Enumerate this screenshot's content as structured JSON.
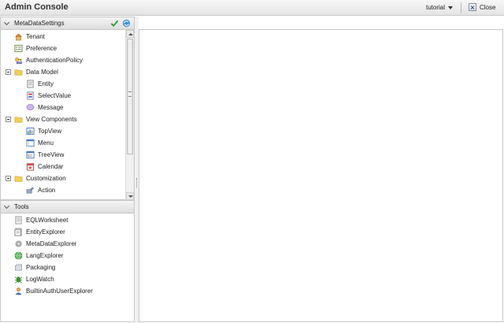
{
  "window": {
    "title": "Admin Console"
  },
  "header": {
    "tenant": "tutorial",
    "close_label": "Close"
  },
  "meta_panel": {
    "title": "MetaDataSettings",
    "items": [
      {
        "label": "Tenant",
        "icon": "house-icon",
        "level": 0
      },
      {
        "label": "Preference",
        "icon": "list-icon",
        "level": 0
      },
      {
        "label": "AuthenticationPolicy",
        "icon": "key-icon",
        "level": 0
      },
      {
        "label": "Data Model",
        "icon": "folder-icon",
        "level": 0,
        "expanded": true
      },
      {
        "label": "Entity",
        "icon": "entity-icon",
        "level": 1
      },
      {
        "label": "SelectValue",
        "icon": "select-value-icon",
        "level": 1
      },
      {
        "label": "Message",
        "icon": "message-icon",
        "level": 1
      },
      {
        "label": "View Components",
        "icon": "folder-icon",
        "level": 0,
        "expanded": true
      },
      {
        "label": "TopView",
        "icon": "topview-icon",
        "level": 1
      },
      {
        "label": "Menu",
        "icon": "menu-icon",
        "level": 1
      },
      {
        "label": "TreeView",
        "icon": "treeview-icon",
        "level": 1
      },
      {
        "label": "Calendar",
        "icon": "calendar-icon",
        "level": 1
      },
      {
        "label": "Customization",
        "icon": "folder-icon",
        "level": 0,
        "expanded": true
      },
      {
        "label": "Action",
        "icon": "action-icon",
        "level": 1
      }
    ]
  },
  "tools_panel": {
    "title": "Tools",
    "items": [
      {
        "label": "EQLWorksheet",
        "icon": "worksheet-icon"
      },
      {
        "label": "EntityExplorer",
        "icon": "entity-explorer-icon"
      },
      {
        "label": "MetaDataExplorer",
        "icon": "gear-icon"
      },
      {
        "label": "LangExplorer",
        "icon": "globe-icon"
      },
      {
        "label": "Packaging",
        "icon": "package-icon"
      },
      {
        "label": "LogWatch",
        "icon": "bug-icon"
      },
      {
        "label": "BuiltinAuthUserExplorer",
        "icon": "user-icon"
      }
    ]
  }
}
